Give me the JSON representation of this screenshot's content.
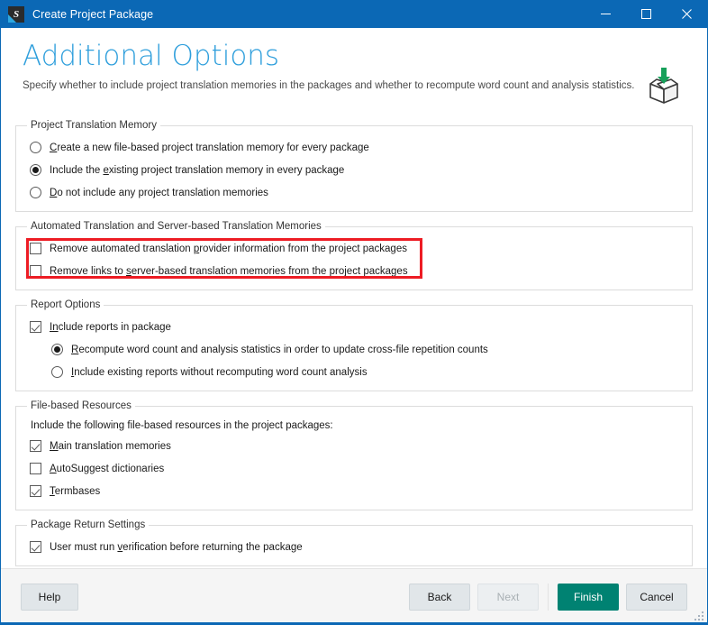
{
  "window": {
    "title": "Create Project Package",
    "icon": "sdl-trados-app-icon",
    "controls": {
      "minimize": "minimize-icon",
      "maximize": "maximize-icon",
      "close": "close-icon"
    },
    "accent_color": "#0b68b5"
  },
  "header": {
    "title": "Additional Options",
    "subtitle": "Specify whether to include project translation memories in the packages and whether to recompute word count and analysis statistics.",
    "icon": "package-download-icon",
    "title_color": "#2f9fdc"
  },
  "annotation": {
    "type": "red-highlight-rectangle",
    "color": "#ed1c24"
  },
  "groups": [
    {
      "legend": "Project Translation Memory",
      "options": [
        {
          "control": "radio",
          "checked": false,
          "pre": "",
          "accel": "C",
          "post": "reate a new file-based project translation memory for every package"
        },
        {
          "control": "radio",
          "checked": true,
          "pre": "Include the ",
          "accel": "e",
          "post": "xisting project translation memory in every package"
        },
        {
          "control": "radio",
          "checked": false,
          "pre": "",
          "accel": "D",
          "post": "o not include any project translation memories"
        }
      ]
    },
    {
      "legend": "Automated Translation and Server-based Translation Memories",
      "options": [
        {
          "control": "checkbox",
          "checked": false,
          "pre": "Remove automated translation ",
          "accel": "p",
          "post": "rovider information from the project packages"
        },
        {
          "control": "checkbox",
          "checked": false,
          "pre": "Remove links to ",
          "accel": "s",
          "post": "erver-based translation memories from the project packages"
        }
      ]
    },
    {
      "legend": "Report Options",
      "options": [
        {
          "control": "checkbox",
          "checked": true,
          "pre": "",
          "accel": "In",
          "post": "clude reports in package"
        },
        {
          "control": "radio",
          "checked": true,
          "indent": true,
          "pre": "",
          "accel": "R",
          "post": "ecompute word count and analysis statistics in order to update cross-file repetition counts"
        },
        {
          "control": "radio",
          "checked": false,
          "indent": true,
          "pre": "",
          "accel": "I",
          "post": "nclude existing reports without recomputing word count analysis"
        }
      ]
    },
    {
      "legend": "File-based Resources",
      "static_text": "Include the following file-based resources in the project packages:",
      "options": [
        {
          "control": "checkbox",
          "checked": true,
          "pre": "",
          "accel": "M",
          "post": "ain translation memories"
        },
        {
          "control": "checkbox",
          "checked": false,
          "pre": "",
          "accel": "A",
          "post": "utoSuggest dictionaries"
        },
        {
          "control": "checkbox",
          "checked": true,
          "pre": "",
          "accel": "T",
          "post": "ermbases"
        }
      ]
    },
    {
      "legend": "Package Return Settings",
      "options": [
        {
          "control": "checkbox",
          "checked": true,
          "pre": "User must run ",
          "accel": "v",
          "post": "erification before returning the package"
        }
      ]
    }
  ],
  "footer": {
    "help": "Help",
    "back": "Back",
    "next": "Next",
    "finish": "Finish",
    "cancel": "Cancel",
    "next_disabled": true,
    "finish_color": "#008272",
    "grip": "resize-grip-icon"
  }
}
